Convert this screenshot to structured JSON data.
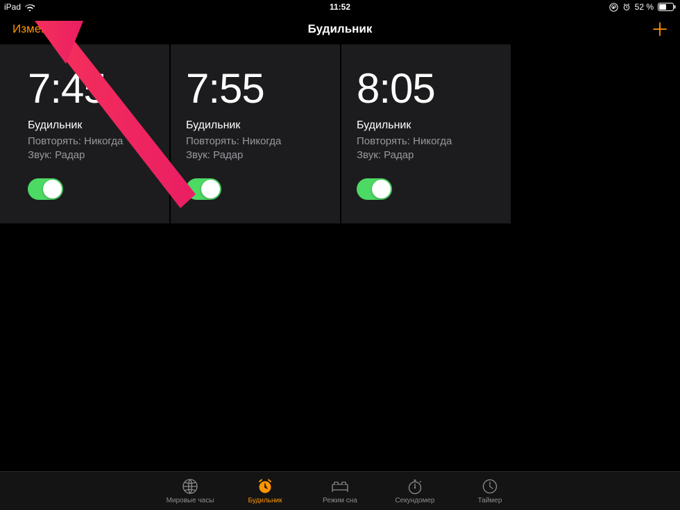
{
  "status_bar": {
    "device": "iPad",
    "time": "11:52",
    "battery_text": "52 %"
  },
  "nav": {
    "edit": "Изменить",
    "title": "Будильник"
  },
  "alarms": [
    {
      "time": "7:45",
      "label": "Будильник",
      "repeat": "Повторять: Никогда",
      "sound": "Звук: Радар",
      "enabled": true
    },
    {
      "time": "7:55",
      "label": "Будильник",
      "repeat": "Повторять: Никогда",
      "sound": "Звук: Радар",
      "enabled": true
    },
    {
      "time": "8:05",
      "label": "Будильник",
      "repeat": "Повторять: Никогда",
      "sound": "Звук: Радар",
      "enabled": true
    }
  ],
  "tabs": {
    "world_clock": "Мировые часы",
    "alarm": "Будильник",
    "bedtime": "Режим сна",
    "stopwatch": "Секундомер",
    "timer": "Таймер",
    "active": "alarm"
  },
  "annotation": {
    "arrow_color": "#F5305B"
  }
}
